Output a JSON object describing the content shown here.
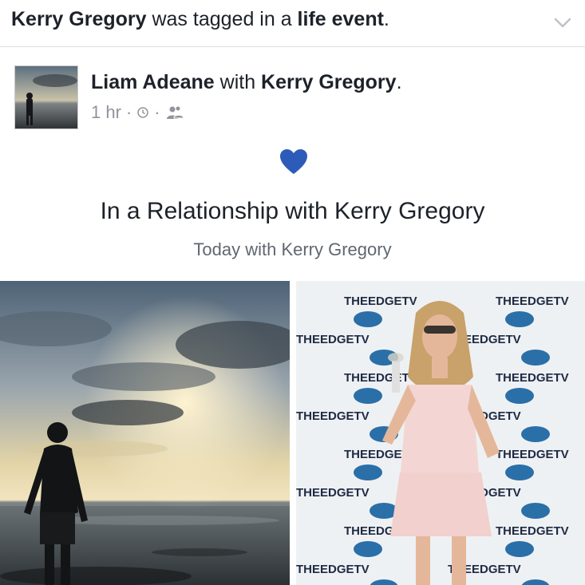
{
  "notification": {
    "actor": "Kerry Gregory",
    "middle": " was tagged in a ",
    "event_word": "life event",
    "end": "."
  },
  "post": {
    "author": "Liam Adeane",
    "with_text": " with ",
    "tagged": "Kerry Gregory",
    "end": ".",
    "time": "1 hr",
    "separator": "·"
  },
  "life_event": {
    "title": "In a Relationship with Kerry Gregory",
    "subtitle": "Today with Kerry Gregory"
  },
  "photos": {
    "backdrop_brand": "THEEDGETV"
  },
  "colors": {
    "heart": "#2d5bb9",
    "meta": "#90949c"
  }
}
